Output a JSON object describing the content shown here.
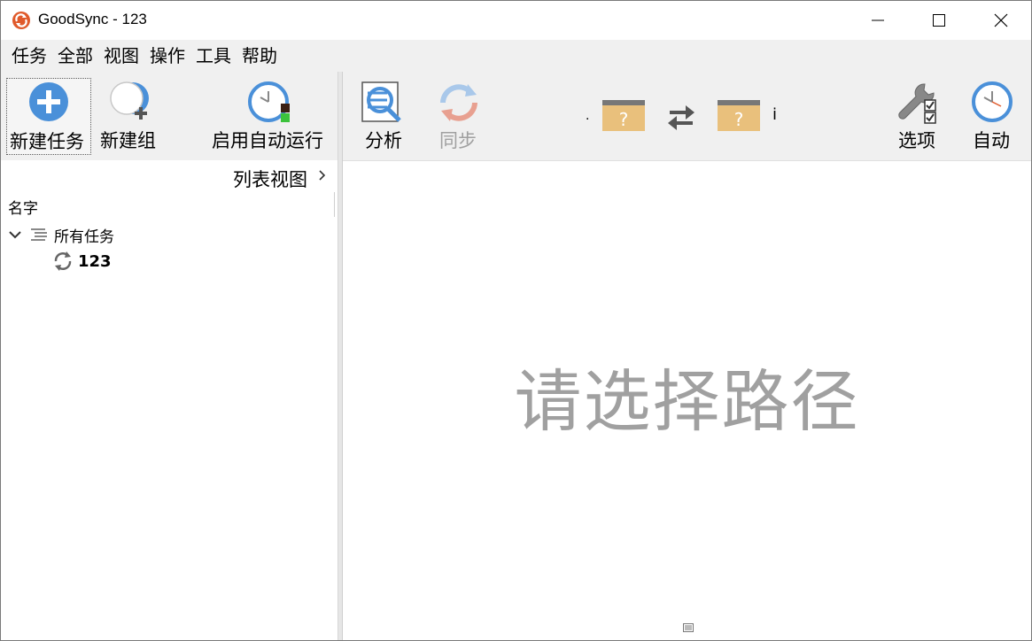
{
  "window": {
    "title": "GoodSync - 123",
    "minimize_icon": "minimize-icon",
    "maximize_icon": "maximize-icon",
    "close_icon": "close-icon"
  },
  "menu": [
    "任务",
    "全部",
    "视图",
    "操作",
    "工具",
    "帮助"
  ],
  "toolbar": {
    "new_task": "新建任务",
    "new_group": "新建组",
    "enable_auto_run": "启用自动运行",
    "analyze": "分析",
    "sync": "同步",
    "left_path": ".",
    "right_path": "i",
    "options": "选项",
    "auto": "自动"
  },
  "left_pane": {
    "list_view_label": "列表视图",
    "column_header": "名字",
    "group_label": "所有任务",
    "task_label": "123"
  },
  "right_pane": {
    "placeholder": "请选择路径"
  },
  "colors": {
    "accent_blue": "#4a90d9",
    "sync_orange": "#e8a090",
    "folder_tan": "#e9c07c",
    "placeholder_gray": "#a0a0a0"
  }
}
